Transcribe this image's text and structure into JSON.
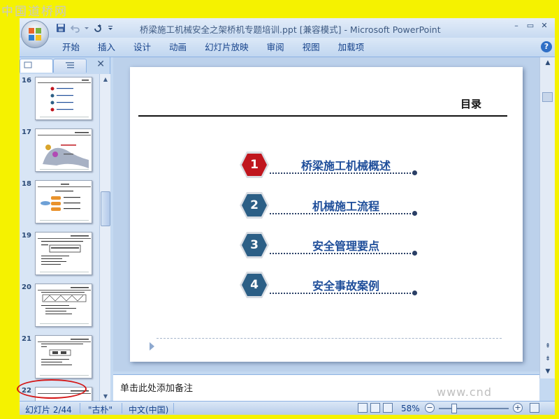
{
  "watermark": "中国道桥网",
  "site_watermark": "www.cnd",
  "window": {
    "title": "桥梁施工机械安全之架桥机专题培训.ppt [兼容模式] - Microsoft PowerPoint",
    "controls": [
      "–",
      "▭",
      "✕"
    ]
  },
  "ribbon": {
    "tabs": [
      "开始",
      "插入",
      "设计",
      "动画",
      "幻灯片放映",
      "审阅",
      "视图",
      "加载项"
    ],
    "help": "?"
  },
  "thumbnails": [
    {
      "num": "16"
    },
    {
      "num": "17"
    },
    {
      "num": "18"
    },
    {
      "num": "19"
    },
    {
      "num": "20"
    },
    {
      "num": "21"
    },
    {
      "num": "22"
    }
  ],
  "slide": {
    "title": "目录",
    "items": [
      {
        "num": "1",
        "label": "桥梁施工机械概述",
        "color": "#c0161e"
      },
      {
        "num": "2",
        "label": "机械施工流程",
        "color": "#2c5f86"
      },
      {
        "num": "3",
        "label": "安全管理要点",
        "color": "#2c5f86"
      },
      {
        "num": "4",
        "label": "安全事故案例",
        "color": "#2c5f86"
      }
    ]
  },
  "notes": {
    "placeholder": "单击此处添加备注"
  },
  "statusbar": {
    "slide_info": "幻灯片 2/44",
    "theme": "\"古朴\"",
    "language": "中文(中国)",
    "zoom": "58%"
  }
}
